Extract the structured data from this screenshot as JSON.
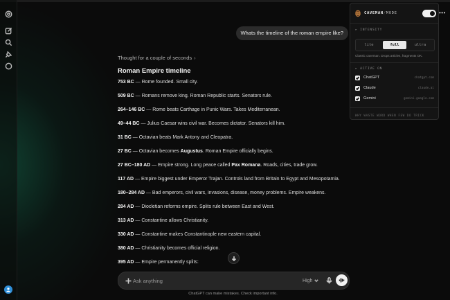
{
  "conversation": {
    "user_message": "Whats the timeline of the roman empire like?",
    "thought_label": "Thought for a couple of seconds",
    "thought_chevron": "›",
    "answer_heading": "Roman Empire timeline",
    "entries": [
      {
        "date": "753 BC",
        "text": " — Rome founded. Small city."
      },
      {
        "date": "509 BC",
        "text": " — Romans remove king. Roman Republic starts. Senators rule."
      },
      {
        "date": "264–146 BC",
        "text": " — Rome beats Carthage in Punic Wars. Takes Mediterranean."
      },
      {
        "date": "49–44 BC",
        "text": " — Julius Caesar wins civil war. Becomes dictator. Senators kill him."
      },
      {
        "date": "31 BC",
        "text": " — Octavian beats Mark Antony and Cleopatra."
      },
      {
        "date": "27 BC",
        "text": " — Octavian becomes ",
        "bold": "Augustus",
        "text2": ". Roman Empire officially begins."
      },
      {
        "date": "27 BC–180 AD",
        "text": " — Empire strong. Long peace called ",
        "bold": "Pax Romana",
        "text2": ". Roads, cities, trade grow."
      },
      {
        "date": "117 AD",
        "text": " — Empire biggest under Emperor Trajan. Controls land from Britain to Egypt and Mesopotamia."
      },
      {
        "date": "180–284 AD",
        "text": " — Bad emperors, civil wars, invasions, disease, money problems. Empire weakens."
      },
      {
        "date": "284 AD",
        "text": " — Diocletian reforms empire. Splits rule between East and West."
      },
      {
        "date": "313 AD",
        "text": " — Constantine allows Christianity."
      },
      {
        "date": "330 AD",
        "text": " — Constantine makes Constantinople new eastern capital."
      },
      {
        "date": "380 AD",
        "text": " — Christianity becomes official religion."
      },
      {
        "date": "395 AD",
        "text": " — Empire permanently splits:"
      }
    ]
  },
  "composer": {
    "placeholder": "Ask anything",
    "model_label": "High",
    "disclaimer": "ChatGPT can make mistakes. Check important info."
  },
  "sidebar": {
    "icons": [
      "openai-logo-icon",
      "new-chat-icon",
      "search-icon",
      "pin-icon",
      "chat-bubble-icon"
    ]
  },
  "extension": {
    "brand_primary": "CAVEMAN",
    "brand_separator": "/",
    "brand_secondary": "MODE",
    "enabled": true,
    "intensity_title": "INTENSITY",
    "intensity_options": [
      "lite",
      "full",
      "ultra"
    ],
    "intensity_selected": "full",
    "intensity_hint": "Classic caveman. Drops articles, fragments OK.",
    "active_title": "ACTIVE ON",
    "sites": [
      {
        "name": "ChatGPT",
        "domain": "chatgpt.com",
        "checked": true
      },
      {
        "name": "Claude",
        "domain": "claude.ai",
        "checked": true
      },
      {
        "name": "Gemini",
        "domain": "gemini.google.com",
        "checked": true
      }
    ],
    "footer": "WHY WASTE WORD WHEN FEW DO TRICK",
    "more_menu": "•••"
  },
  "colors": {
    "background": "#0b0b0b",
    "accent_glow": "#146e50",
    "avatar": "#2f8fd8"
  }
}
